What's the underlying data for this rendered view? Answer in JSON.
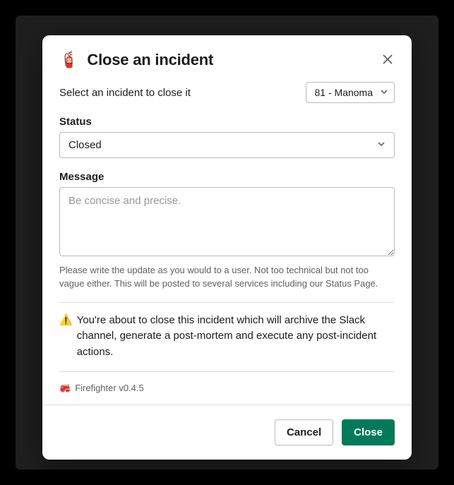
{
  "modal": {
    "title": "Close an incident",
    "intro": "Select an incident to close it",
    "incident_selected": "81 - Manoma",
    "status": {
      "label": "Status",
      "value": "Closed"
    },
    "message": {
      "label": "Message",
      "placeholder": "Be concise and precise.",
      "value": "",
      "helper": "Please write the update as you would to a user. Not too technical but not too vague either. This will be posted to several services including our Status Page."
    },
    "warning": "You're about to close this incident which will archive the Slack channel, generate a post-mortem and execute any post-incident actions.",
    "app_meta": "Firefighter v0.4.5",
    "buttons": {
      "cancel": "Cancel",
      "submit": "Close"
    }
  }
}
